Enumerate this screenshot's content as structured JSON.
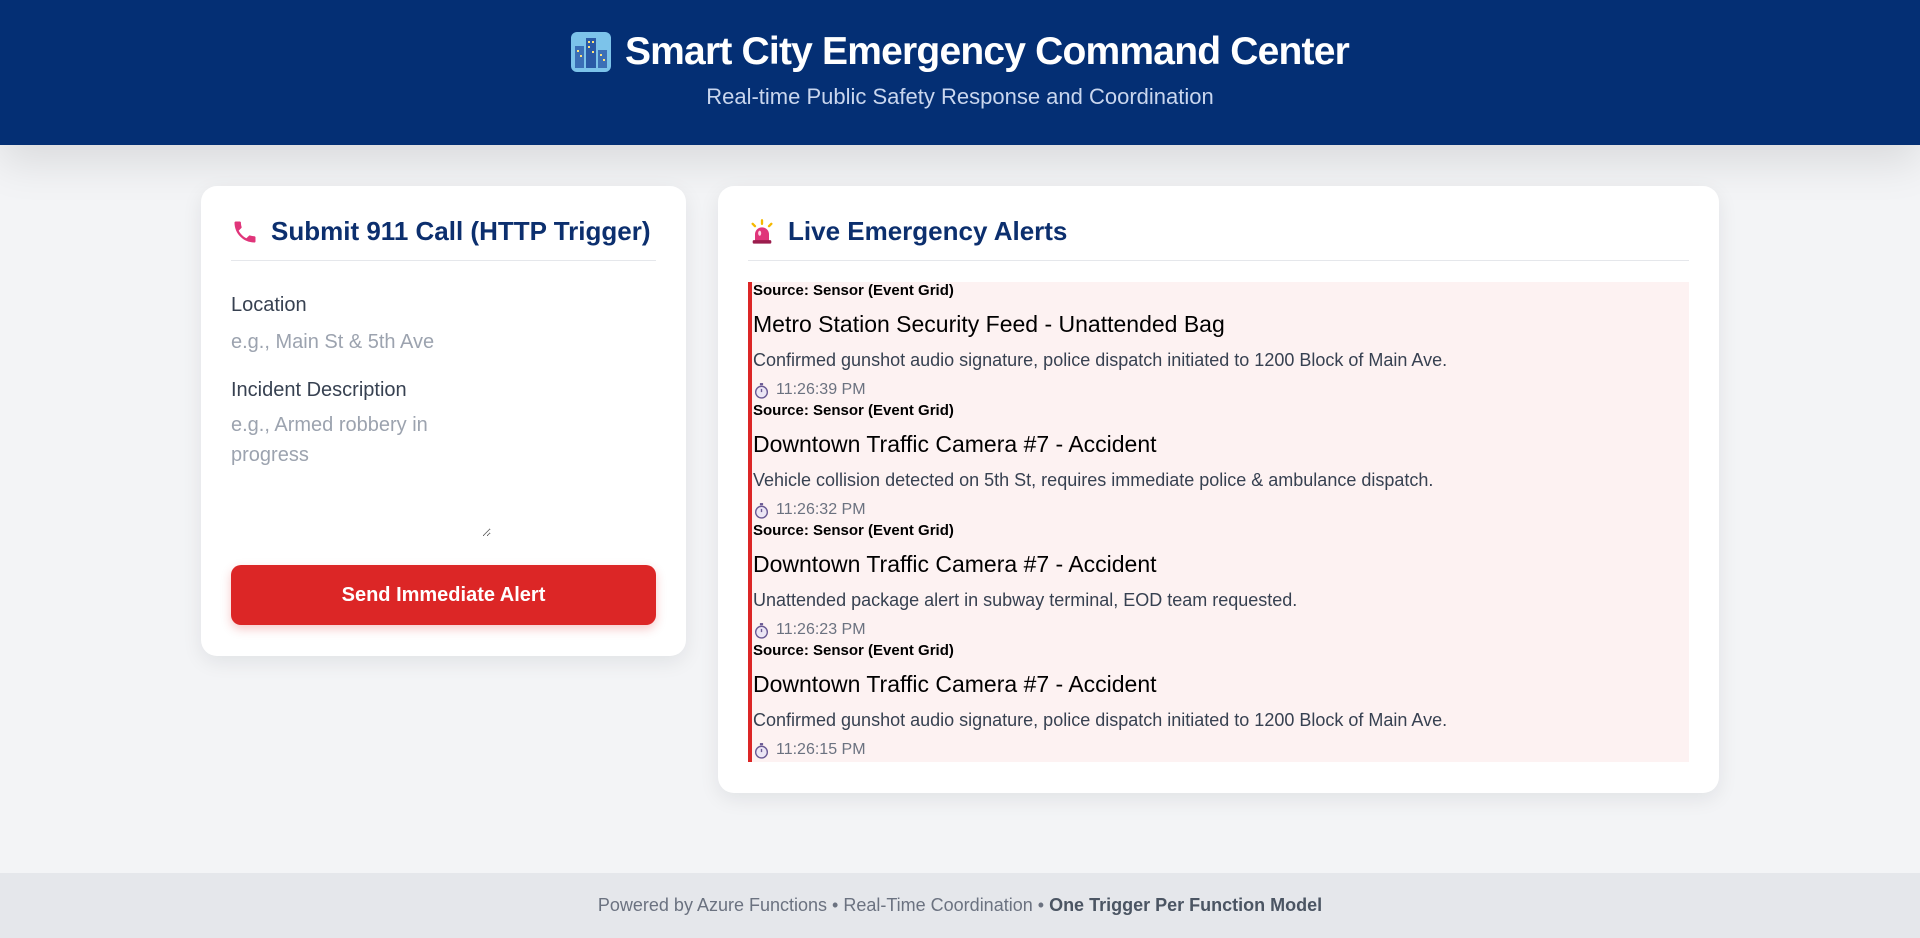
{
  "header": {
    "title": "Smart City Emergency Command Center",
    "subtitle": "Real-time Public Safety Response and Coordination",
    "icon": "city-icon"
  },
  "submit_panel": {
    "title": "Submit 911 Call (HTTP Trigger)",
    "icon": "phone-icon",
    "location_label": "Location",
    "location_placeholder": "e.g., Main St & 5th Ave",
    "location_value": "",
    "description_label": "Incident Description",
    "description_placeholder": "e.g., Armed robbery in progress",
    "description_value": "",
    "send_label": "Send Immediate Alert"
  },
  "alerts_panel": {
    "title": "Live Emergency Alerts",
    "icon": "siren-icon",
    "alerts": [
      {
        "source": "Source: Sensor (Event Grid)",
        "title": "Metro Station Security Feed - Unattended Bag",
        "description": "Confirmed gunshot audio signature, police dispatch initiated to 1200 Block of Main Ave.",
        "time": "11:26:39 PM"
      },
      {
        "source": "Source: Sensor (Event Grid)",
        "title": "Downtown Traffic Camera #7 - Accident",
        "description": "Vehicle collision detected on 5th St, requires immediate police & ambulance dispatch.",
        "time": "11:26:32 PM"
      },
      {
        "source": "Source: Sensor (Event Grid)",
        "title": "Downtown Traffic Camera #7 - Accident",
        "description": "Unattended package alert in subway terminal, EOD team requested.",
        "time": "11:26:23 PM"
      },
      {
        "source": "Source: Sensor (Event Grid)",
        "title": "Downtown Traffic Camera #7 - Accident",
        "description": "Confirmed gunshot audio signature, police dispatch initiated to 1200 Block of Main Ave.",
        "time": "11:26:15 PM"
      }
    ]
  },
  "footer": {
    "text": "Powered by Azure Functions • Real-Time Coordination •",
    "bold_text": "One Trigger Per Function Model"
  },
  "colors": {
    "header_bg": "#042f74",
    "accent_red": "#dc2626",
    "panel_title": "#0c2f6e",
    "alert_bg": "#fdf2f2"
  }
}
